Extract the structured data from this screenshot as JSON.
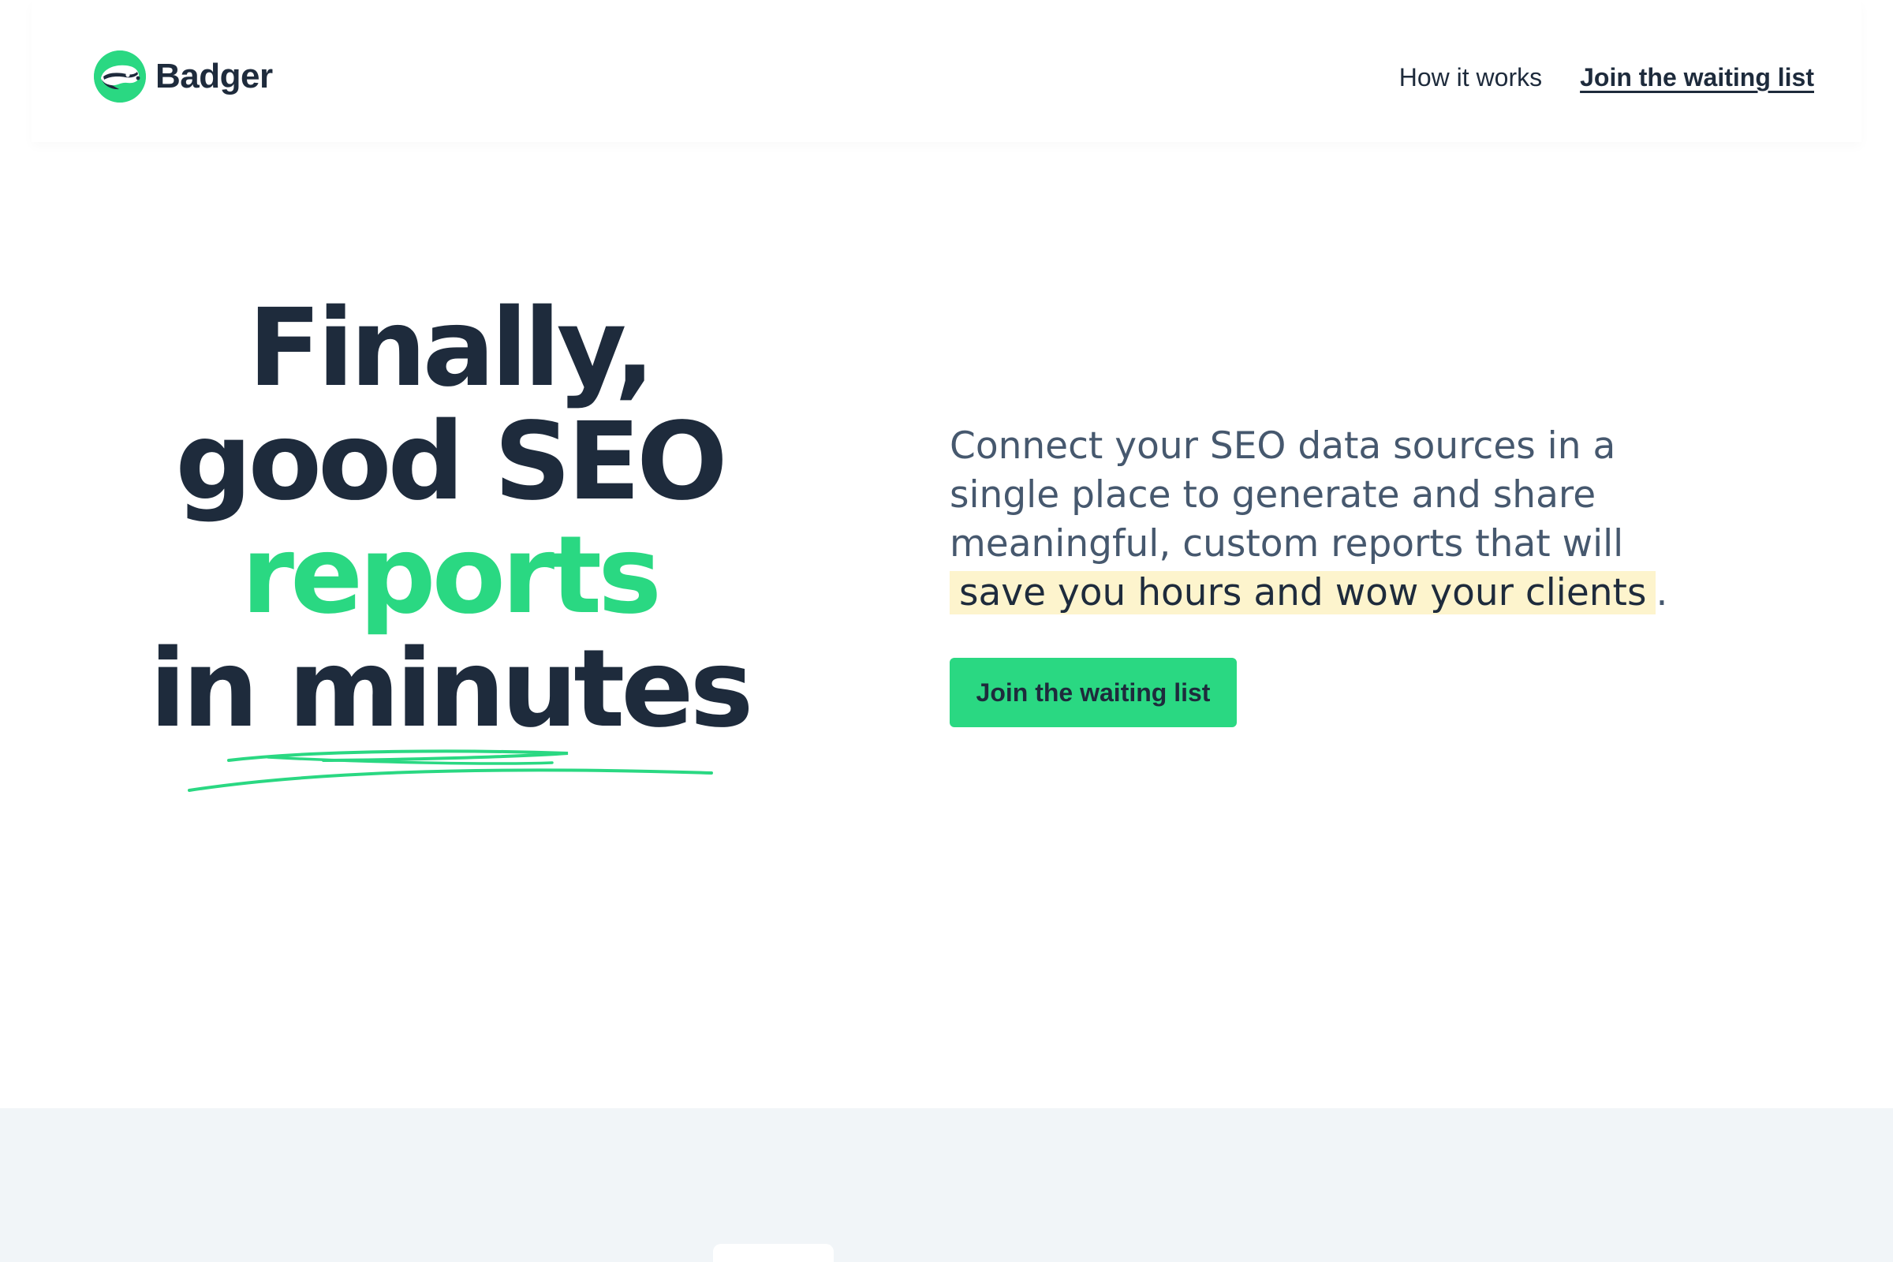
{
  "brand": {
    "name": "Badger",
    "logo_icon": "badger-icon",
    "accent_color": "#2ad882",
    "text_color": "#1e2b3c"
  },
  "nav": {
    "how_it_works": "How it works",
    "join_waiting_list": "Join the waiting list"
  },
  "hero": {
    "headline": {
      "line1": "Finally,",
      "line2": "good SEO",
      "line3": "reports",
      "line4": "in minutes"
    },
    "intro_text": "Connect your SEO data sources in a single place to generate and share meaningful, custom reports that will",
    "intro_highlight": "save you hours and wow your clients",
    "intro_end": ".",
    "highlight_color": "#fdf4cd",
    "cta_label": "Join the waiting list"
  },
  "lower_section": {
    "background_color": "#f1f5f8"
  }
}
